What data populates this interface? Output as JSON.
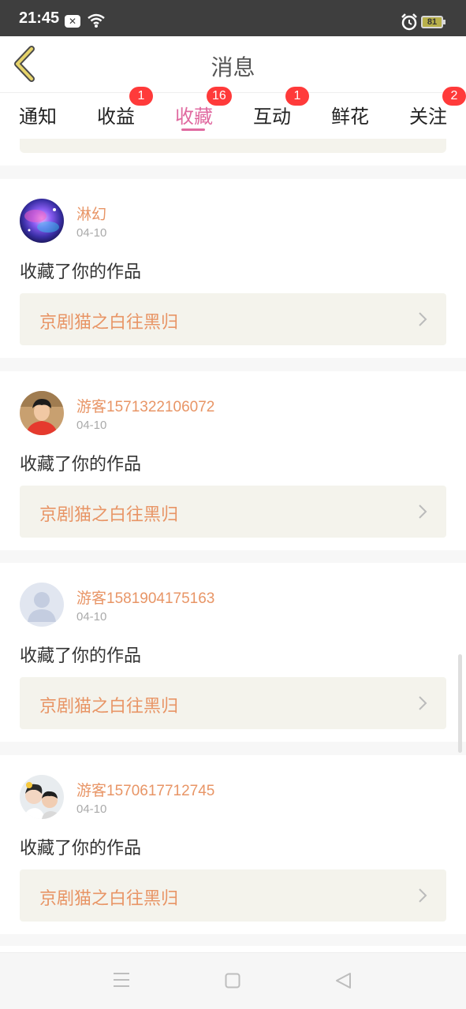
{
  "status_bar": {
    "time": "21:45",
    "notification_icon": "x-icon",
    "battery": "81"
  },
  "header": {
    "title": "消息",
    "back_icon": "chevron-left-icon"
  },
  "tabs": [
    {
      "label": "通知",
      "badge": ""
    },
    {
      "label": "收益",
      "badge": "1"
    },
    {
      "label": "收藏",
      "badge": "16",
      "active": true
    },
    {
      "label": "互动",
      "badge": "1"
    },
    {
      "label": "鲜花",
      "badge": ""
    },
    {
      "label": "关注",
      "badge": "2"
    }
  ],
  "messages": [
    {
      "username": "淋幻",
      "date": "04-10",
      "action": "收藏了你的作品",
      "work_title": "京剧猫之白往黑归",
      "avatar": "galaxy-avatar"
    },
    {
      "username": "游客1571322106072",
      "date": "04-10",
      "action": "收藏了你的作品",
      "work_title": "京剧猫之白往黑归",
      "avatar": "boy-avatar"
    },
    {
      "username": "游客1581904175163",
      "date": "04-10",
      "action": "收藏了你的作品",
      "work_title": "京剧猫之白往黑归",
      "avatar": "default-avatar"
    },
    {
      "username": "游客1570617712745",
      "date": "04-10",
      "action": "收藏了你的作品",
      "work_title": "京剧猫之白往黑归",
      "avatar": "kids-avatar"
    }
  ],
  "colors": {
    "accent": "#e06aa0",
    "badge": "#ff3a3a",
    "username": "#e89566",
    "link_bg": "#f4f3ec"
  }
}
